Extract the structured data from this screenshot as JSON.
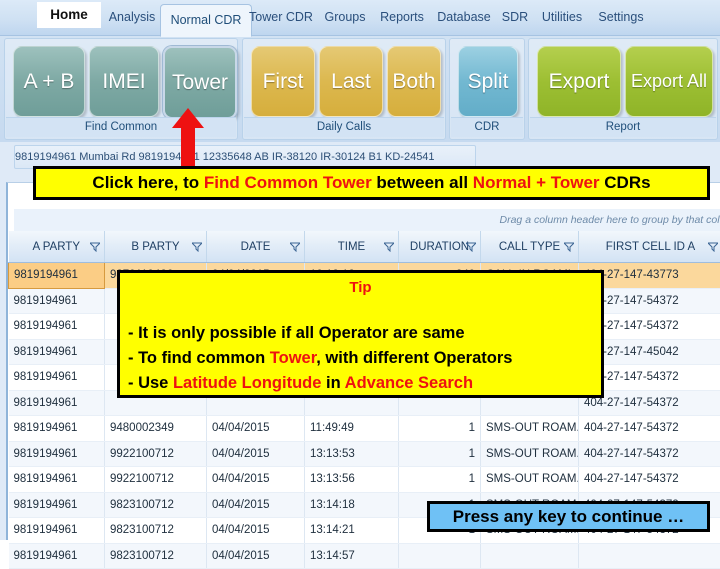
{
  "ribbon": {
    "tabs": [
      {
        "label": "Home",
        "state": "home"
      },
      {
        "label": "Analysis",
        "state": "normal"
      },
      {
        "label": "Normal CDR",
        "state": "active"
      },
      {
        "label": "Tower CDR",
        "state": "normal"
      },
      {
        "label": "Groups",
        "state": "normal"
      },
      {
        "label": "Reports",
        "state": "normal"
      },
      {
        "label": "Database",
        "state": "normal"
      },
      {
        "label": "SDR",
        "state": "normal"
      },
      {
        "label": "Utilities",
        "state": "normal"
      },
      {
        "label": "Settings",
        "state": "normal"
      }
    ],
    "groups": [
      {
        "label": "Find Common",
        "buttons": [
          {
            "label": "A + B",
            "color": "teal",
            "selected": false
          },
          {
            "label": "IMEI",
            "color": "teal",
            "selected": false
          },
          {
            "label": "Tower",
            "color": "teal",
            "selected": true
          }
        ]
      },
      {
        "label": "Daily Calls",
        "buttons": [
          {
            "label": "First",
            "color": "gold",
            "selected": false
          },
          {
            "label": "Last",
            "color": "gold",
            "selected": false
          },
          {
            "label": "Both",
            "color": "gold",
            "selected": false
          }
        ]
      },
      {
        "label": "CDR",
        "buttons": [
          {
            "label": "Split",
            "color": "blue",
            "selected": false
          }
        ]
      },
      {
        "label": "Report",
        "buttons": [
          {
            "label": "Export",
            "color": "green",
            "selected": false
          },
          {
            "label": "Export All",
            "color": "green",
            "selected": false
          }
        ]
      }
    ]
  },
  "grid": {
    "background_row": "9819194961   Mumbai Rd   9819194961  12335648    AB    IR-38120    IR-30124    B1    KD-24541",
    "drag_hint": "Drag a column header here to group by that column",
    "columns": [
      {
        "label": "A PARTY",
        "filter": true
      },
      {
        "label": "B PARTY",
        "filter": true
      },
      {
        "label": "DATE",
        "filter": true
      },
      {
        "label": "TIME",
        "filter": true
      },
      {
        "label": "DURATION",
        "filter": true
      },
      {
        "label": "CALL TYPE",
        "filter": true
      },
      {
        "label": "FIRST CELL ID A",
        "filter": true
      }
    ],
    "rows": [
      {
        "a_party": "9819194961",
        "b_party": "9870119426",
        "date": "04/04/2015",
        "time": "10:12:12",
        "duration": "240",
        "call_type": "CALL-IN  ROAMI...",
        "first_cell_id_a": "404-27-147-43773",
        "selected": true
      },
      {
        "a_party": "9819194961",
        "b_party": "",
        "date": "",
        "time": "",
        "duration": "",
        "call_type": "",
        "first_cell_id_a": "404-27-147-54372",
        "selected": false
      },
      {
        "a_party": "9819194961",
        "b_party": "",
        "date": "",
        "time": "",
        "duration": "",
        "call_type": "",
        "first_cell_id_a": "404-27-147-54372",
        "selected": false
      },
      {
        "a_party": "9819194961",
        "b_party": "",
        "date": "",
        "time": "",
        "duration": "",
        "call_type": "",
        "first_cell_id_a": "404-27-147-45042",
        "selected": false
      },
      {
        "a_party": "9819194961",
        "b_party": "",
        "date": "",
        "time": "",
        "duration": "",
        "call_type": "",
        "first_cell_id_a": "404-27-147-54372",
        "selected": false
      },
      {
        "a_party": "9819194961",
        "b_party": "",
        "date": "",
        "time": "",
        "duration": "",
        "call_type": "",
        "first_cell_id_a": "404-27-147-54372",
        "selected": false
      },
      {
        "a_party": "9819194961",
        "b_party": "9480002349",
        "date": "04/04/2015",
        "time": "11:49:49",
        "duration": "1",
        "call_type": "SMS-OUT ROAM...",
        "first_cell_id_a": "404-27-147-54372",
        "selected": false
      },
      {
        "a_party": "9819194961",
        "b_party": "9922100712",
        "date": "04/04/2015",
        "time": "13:13:53",
        "duration": "1",
        "call_type": "SMS-OUT ROAM...",
        "first_cell_id_a": "404-27-147-54372",
        "selected": false
      },
      {
        "a_party": "9819194961",
        "b_party": "9922100712",
        "date": "04/04/2015",
        "time": "13:13:56",
        "duration": "1",
        "call_type": "SMS-OUT ROAM...",
        "first_cell_id_a": "404-27-147-54372",
        "selected": false
      },
      {
        "a_party": "9819194961",
        "b_party": "9823100712",
        "date": "04/04/2015",
        "time": "13:14:18",
        "duration": "1",
        "call_type": "SMS-OUT ROAM...",
        "first_cell_id_a": "404-27-147-54372",
        "selected": false
      },
      {
        "a_party": "9819194961",
        "b_party": "9823100712",
        "date": "04/04/2015",
        "time": "13:14:21",
        "duration": "1",
        "call_type": "SMS-OUT ROAM...",
        "first_cell_id_a": "404-27-147-54372",
        "selected": false
      },
      {
        "a_party": "9819194961",
        "b_party": "9823100712",
        "date": "04/04/2015",
        "time": "13:14:57",
        "duration": "",
        "call_type": "",
        "first_cell_id_a": "",
        "selected": false
      }
    ]
  },
  "callout": {
    "part1": "Click here, to ",
    "highlight1": "Find Common Tower",
    "part2": " between all ",
    "highlight2": "Normal + Tower",
    "part3": " CDRs"
  },
  "tip": {
    "title": "Tip",
    "line1_a": "- It is only possible if all Operator are same",
    "line2_a": "- To find common ",
    "line2_hl": "Tower",
    "line2_b": ", with different Operators",
    "line3_a": "- Use ",
    "line3_hl1": "Latitude Longitude",
    "line3_b": " in ",
    "line3_hl2": "Advance Search"
  },
  "press_key": {
    "label": "Press any key to continue …"
  },
  "colors": {
    "callout_bg": "#ffff00",
    "callout_accent": "#ee1111",
    "press_key_bg": "#6fc1f5",
    "arrow": "#ee1111",
    "selected_row": "#fbd89c"
  }
}
